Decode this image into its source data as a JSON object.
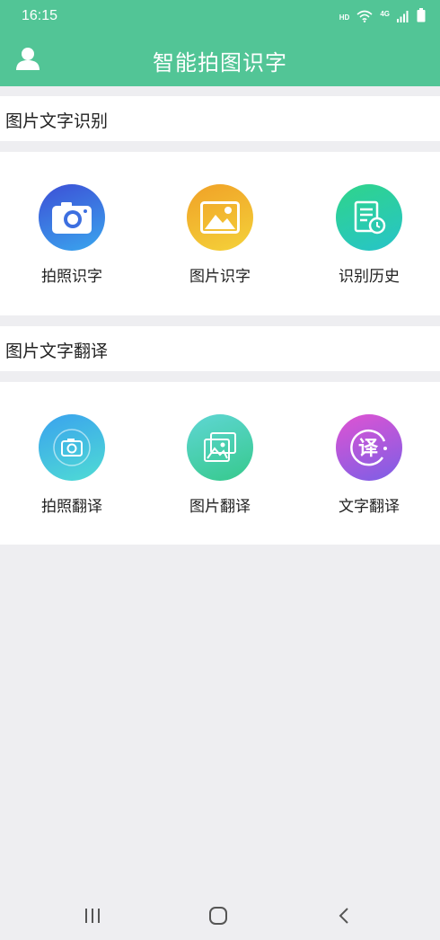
{
  "status_bar": {
    "time": "16:15",
    "hd_label": "HD",
    "network_label": "4G",
    "icons": [
      "wifi-icon",
      "signal-icon",
      "battery-icon"
    ]
  },
  "app_bar": {
    "title": "智能拍图识字",
    "avatar_icon": "user-avatar-icon"
  },
  "sections": [
    {
      "header": "图片文字识别",
      "tiles": [
        {
          "label": "拍照识字",
          "icon": "camera-icon"
        },
        {
          "label": "图片识字",
          "icon": "image-icon"
        },
        {
          "label": "识别历史",
          "icon": "history-icon"
        }
      ]
    },
    {
      "header": "图片文字翻译",
      "tiles": [
        {
          "label": "拍照翻译",
          "icon": "camera-translate-icon"
        },
        {
          "label": "图片翻译",
          "icon": "image-translate-icon"
        },
        {
          "label": "文字翻译",
          "icon": "text-translate-icon"
        }
      ]
    }
  ],
  "nav_bar": {
    "buttons": [
      "recent-apps-icon",
      "home-icon",
      "back-icon"
    ]
  },
  "colors": {
    "brand": "#52c596",
    "page_background": "#eeeef1"
  }
}
